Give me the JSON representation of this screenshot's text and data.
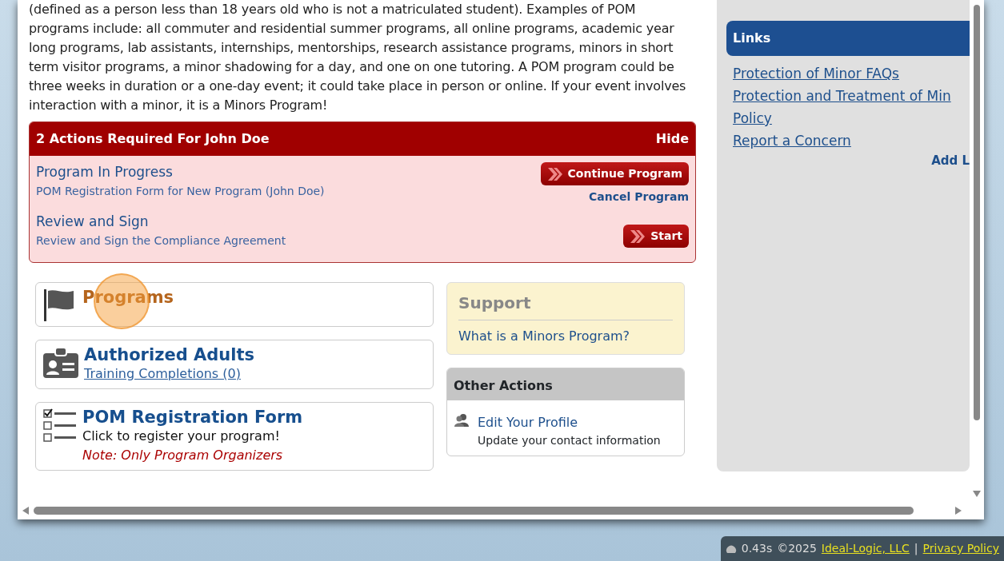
{
  "intro": "(defined as a person less than 18 years old who is not a matriculated student).  Examples of POM programs include: all commuter and residential summer programs, all online programs, academic year long programs, lab assistants, internships, mentorships, research assistance programs, minors in short term visitor programs, a minor shadowing for a day, and one on one tutoring.  A POM program could be three weeks in duration or a one-day event; it could take place in person or online.  If your event involves interaction with a minor, it is a Minors Program!",
  "actions": {
    "title": "2 Actions Required For John Doe",
    "hide": "Hide",
    "items": [
      {
        "title": "Program In Progress",
        "subtitle": "POM Registration Form for New Program (John Doe)",
        "button": "Continue Program",
        "secondary": "Cancel Program"
      },
      {
        "title": "Review and Sign",
        "subtitle": "Review and Sign the Compliance Agreement",
        "button": "Start"
      }
    ]
  },
  "tiles": [
    {
      "kind": "flag",
      "title": "Programs",
      "clicked": true
    },
    {
      "kind": "badge",
      "title": "Authorized Adults",
      "subtitle": "Training Completions (0)",
      "clicked": false
    },
    {
      "kind": "checklist",
      "title": "POM Registration Form",
      "text": "Click to register your program!",
      "note": "Note: Only Program Organizers",
      "clicked": false
    }
  ],
  "support": {
    "title": "Support",
    "links": [
      "What is a Minors Program?"
    ]
  },
  "other_actions": {
    "title": "Other Actions",
    "items": [
      {
        "title": "Edit Your Profile",
        "subtitle": "Update your contact information"
      }
    ]
  },
  "links_panel": {
    "title": "Links",
    "links": [
      "Protection of Minor FAQs",
      "Protection and Treatment of Min",
      "Policy",
      "Report a Concern"
    ],
    "add": "Add L"
  },
  "footer": {
    "time": "0.43s",
    "copyright": "©2025",
    "company": "Ideal-Logic, LLC",
    "separator": "|",
    "privacy": "Privacy Policy"
  }
}
